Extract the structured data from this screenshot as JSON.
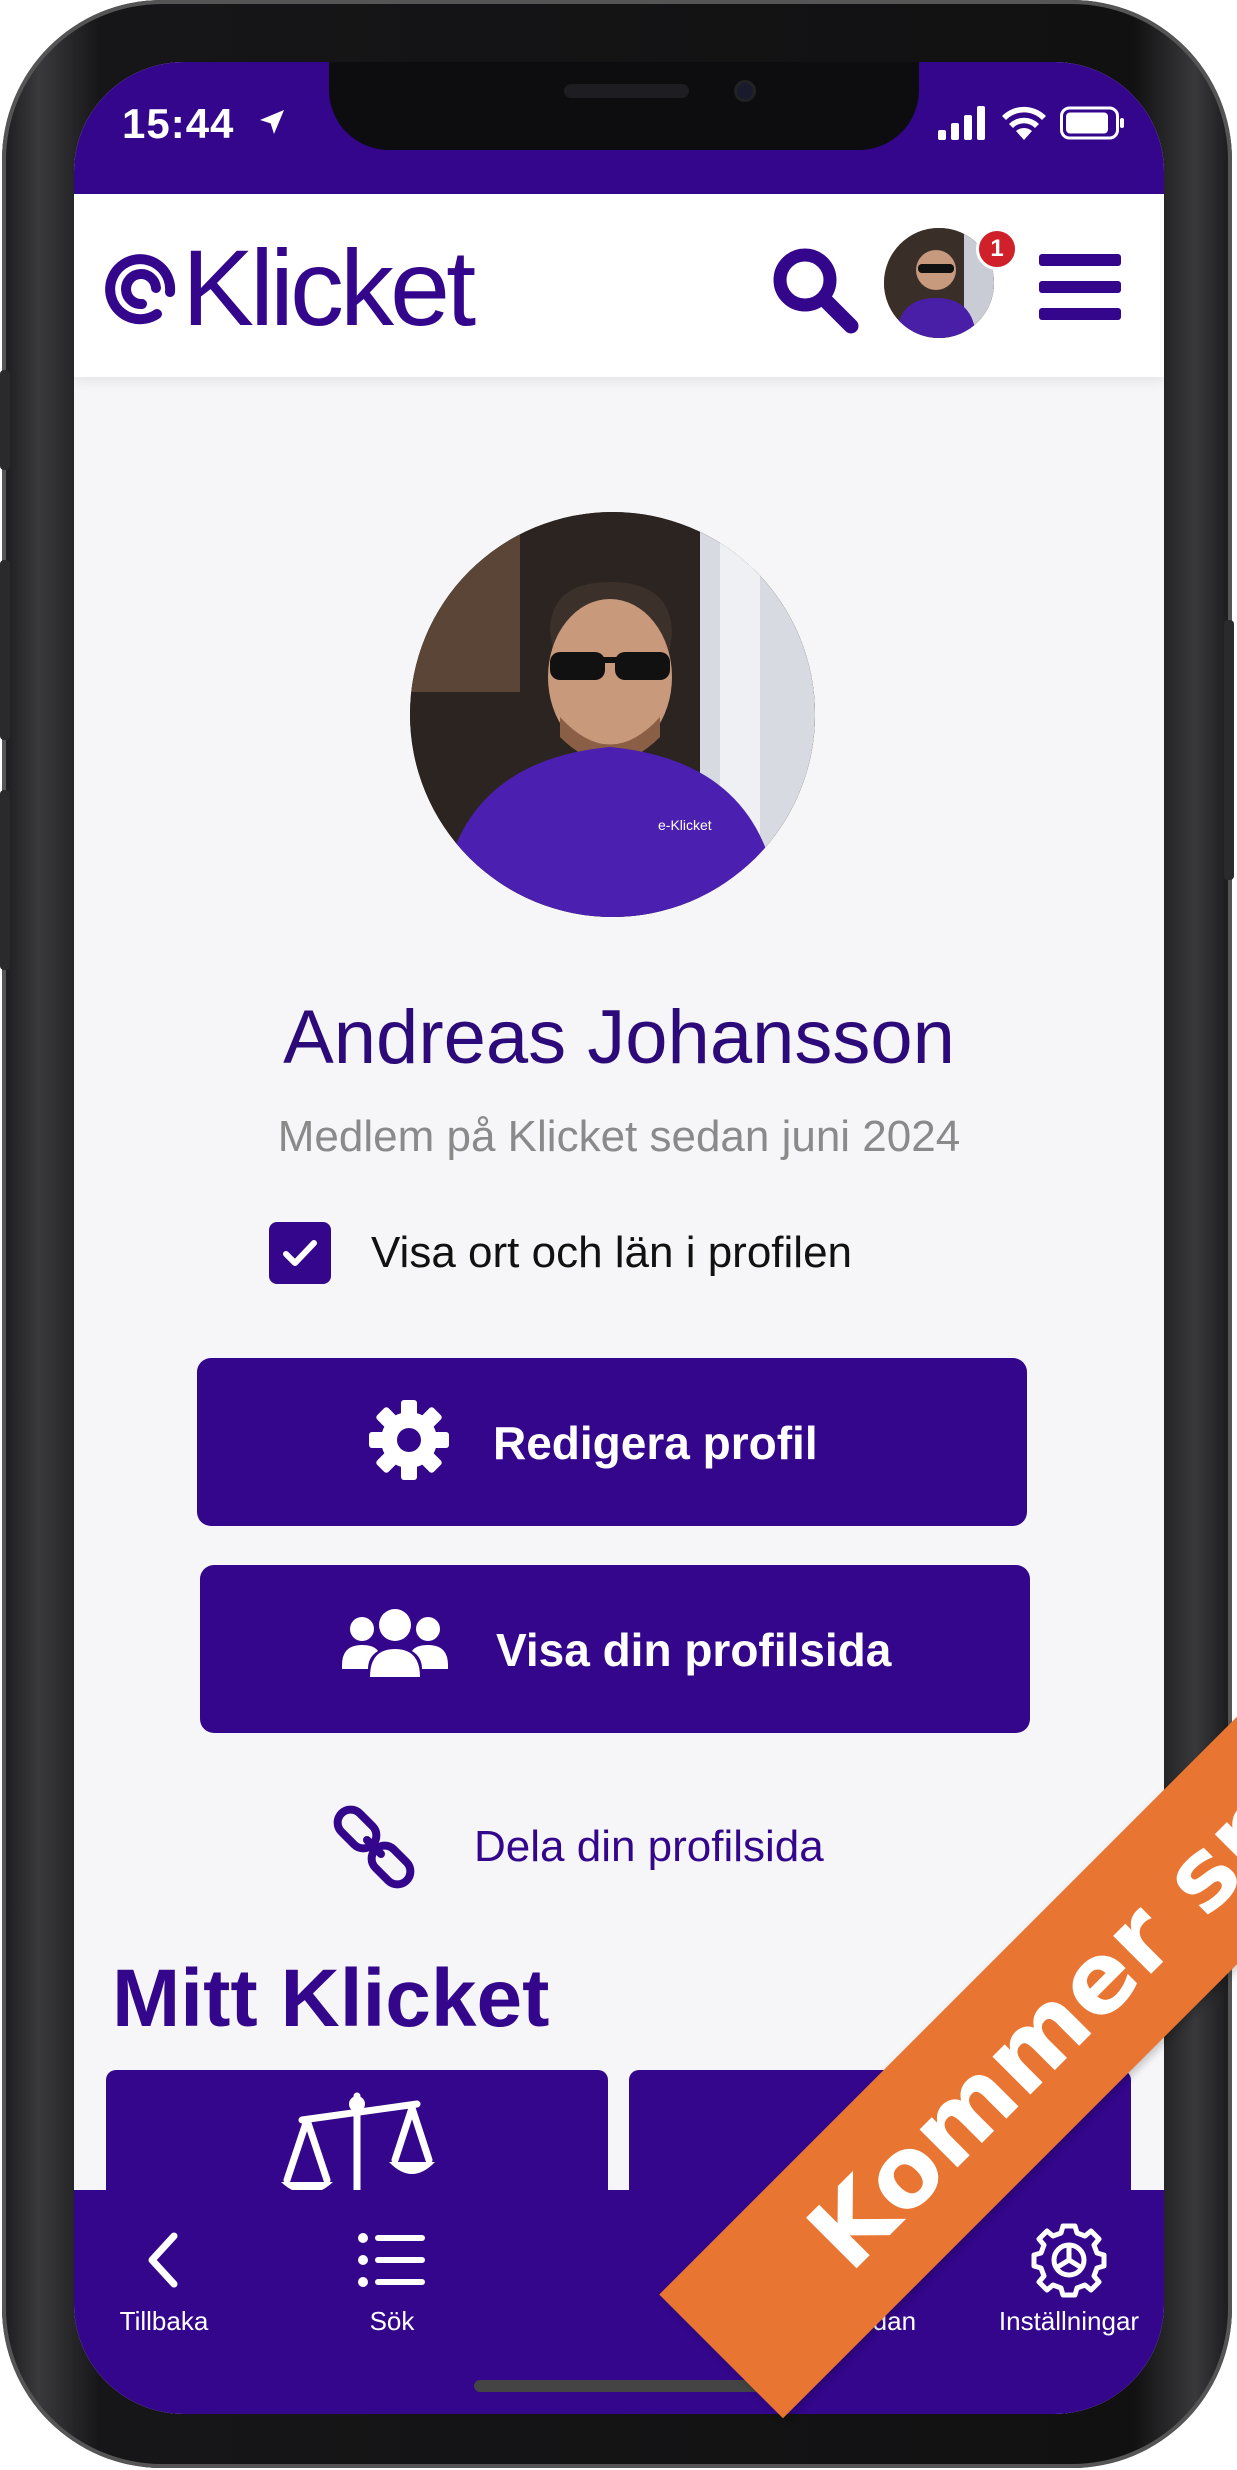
{
  "status_bar": {
    "time": "15:44"
  },
  "header": {
    "logo_text": "Klicket",
    "notification_count": "1"
  },
  "profile": {
    "name": "Andreas Johansson",
    "member_since": "Medlem på Klicket sedan juni 2024",
    "show_location_label": "Visa ort och län i profilen",
    "show_location_checked": true,
    "edit_button": "Redigera profil",
    "view_button": "Visa din profilsida",
    "share_link": "Dela din profilsida"
  },
  "section": {
    "title": "Mitt Klicket"
  },
  "tabbar": {
    "items": [
      {
        "label": "Tillbaka",
        "icon": "chevron-left-icon"
      },
      {
        "label": "Sök",
        "icon": "list-icon"
      },
      {
        "label": "ela sidan",
        "icon": "share-icon"
      },
      {
        "label": "Inställningar",
        "icon": "settings-icon"
      }
    ]
  },
  "banner": {
    "text": "Kommer snart!"
  },
  "colors": {
    "brand": "#33068c",
    "banner": "#e97532",
    "badge": "#d0202a"
  }
}
